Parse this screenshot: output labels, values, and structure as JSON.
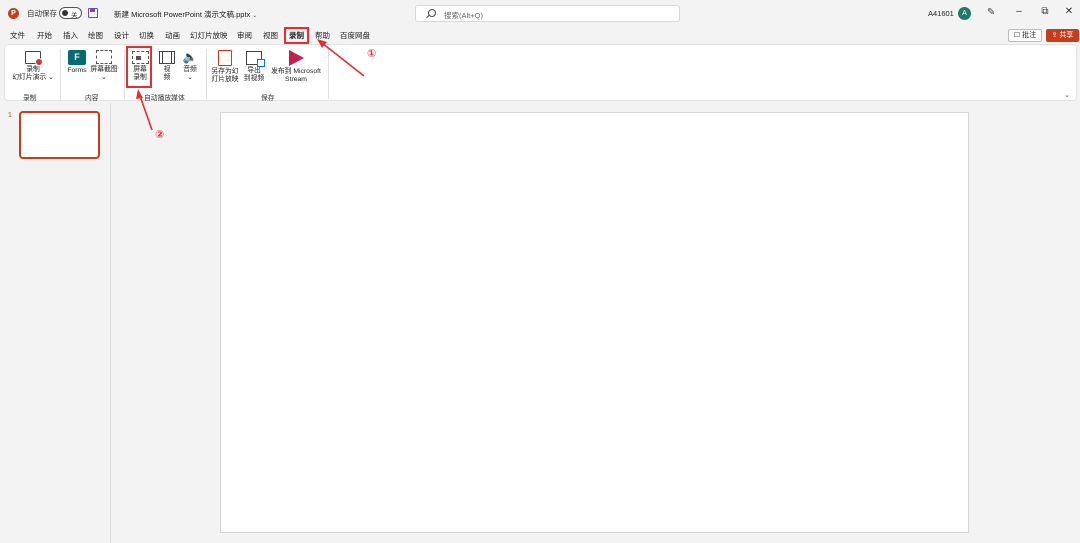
{
  "titlebar": {
    "app_icon": "powerpoint-icon",
    "autosave_label": "自动保存",
    "toggle_state": "关",
    "save_icon": "save-icon",
    "document_title": "新建 Microsoft PowerPoint 演示文稿.pptx",
    "title_caret": "⌄",
    "search_placeholder": "搜索(Alt+Q)",
    "user_id": "A41601",
    "avatar_letter": "A",
    "pen_icon": "pen-icon",
    "minimize": "–",
    "restore": "⧉",
    "close": "✕"
  },
  "menu": {
    "tabs": [
      "文件",
      "开始",
      "插入",
      "绘图",
      "设计",
      "切换",
      "动画",
      "幻灯片放映",
      "审阅",
      "视图",
      "录制",
      "帮助",
      "百度网盘"
    ],
    "active_tab": "录制",
    "comment_label": "☐ 批注",
    "share_label": "⇪ 共享"
  },
  "ribbon": {
    "groups": {
      "record": "录制",
      "content": "内容",
      "auto_media": "自动播放媒体",
      "save": "保存"
    },
    "buttons": {
      "record_slideshow_1": "录制",
      "record_slideshow_2": "幻灯片演示 ⌄",
      "forms": "Forms",
      "screenshot": "屏幕截图",
      "screenshot_caret": "⌄",
      "screen_record_1": "屏幕",
      "screen_record_2": "录制",
      "video_1": "视",
      "video_2": "频",
      "audio_1": "音频",
      "audio_2": "⌄",
      "save_as_show_1": "另存为幻",
      "save_as_show_2": "灯片放映",
      "export_video_1": "导出",
      "export_video_2": "到视频",
      "publish_stream_1": "发布到 Microsoft",
      "publish_stream_2": "Stream"
    },
    "collapse": "⌄"
  },
  "slides": {
    "thumb_number": "1"
  },
  "annotations": {
    "step1": "①",
    "step2": "②"
  },
  "colors": {
    "accent": "#c43e1c",
    "annotation": "#e03030",
    "forms": "#036c70",
    "stream": "#c4204e",
    "avatar": "#1f7a6b"
  }
}
